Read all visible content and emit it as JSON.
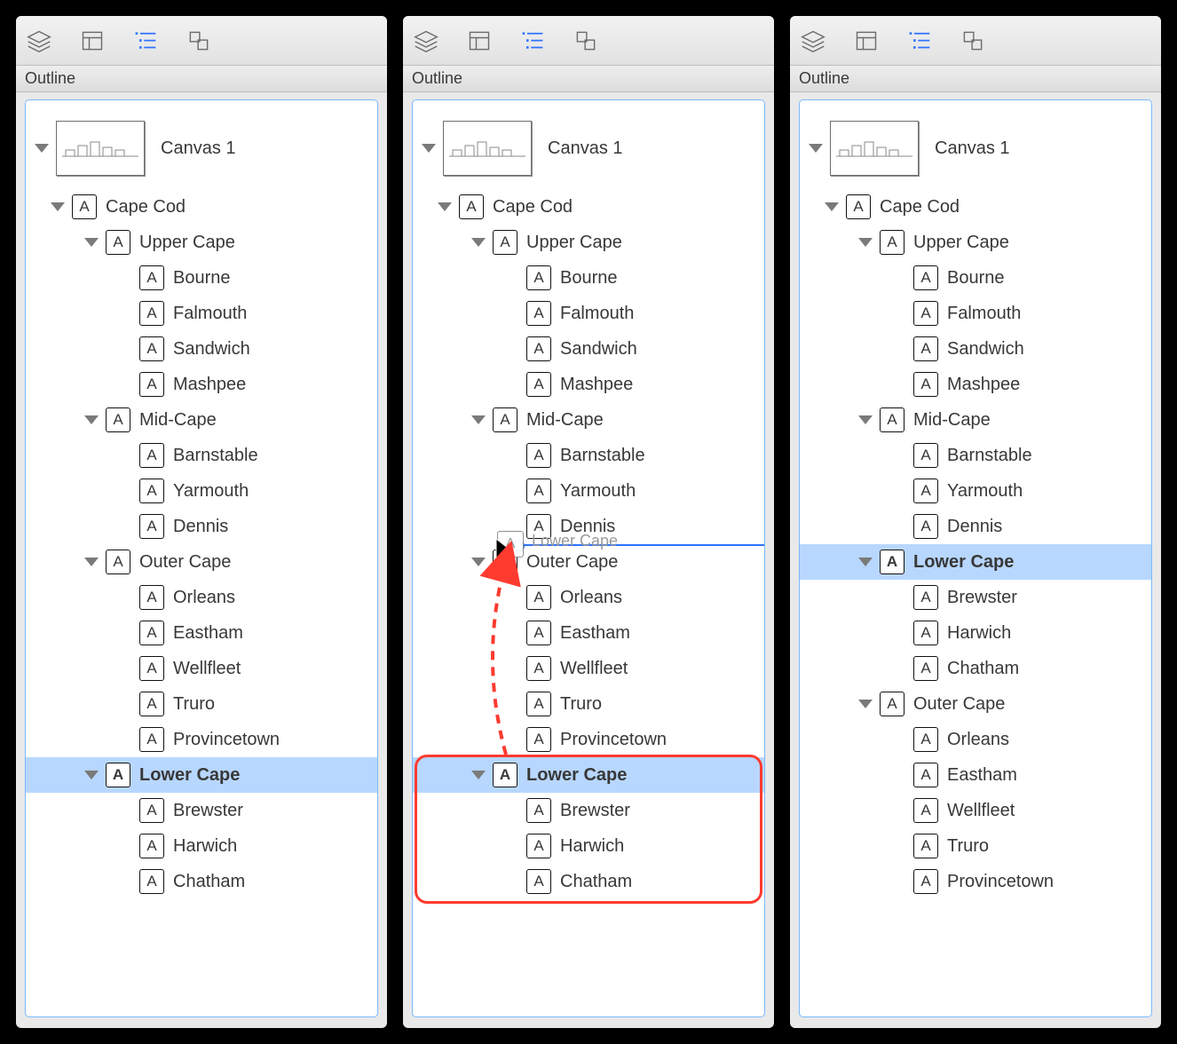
{
  "section_label": "Outline",
  "canvas_label": "Canvas 1",
  "a_glyph": "A",
  "badge_suffix": "-icon",
  "panels": [
    {
      "id": "panel-before",
      "selected_key": "lower-cape",
      "extras": {
        "ghost": false,
        "drop_line": false,
        "red_box": false,
        "arrow": false,
        "cursor": false
      },
      "rows": [
        {
          "key": "cape-cod",
          "label": "Cape Cod",
          "depth": 0,
          "disclosure": true
        },
        {
          "key": "upper-cape",
          "label": "Upper Cape",
          "depth": 1,
          "disclosure": true
        },
        {
          "key": "bourne",
          "label": "Bourne",
          "depth": 2,
          "disclosure": false
        },
        {
          "key": "falmouth",
          "label": "Falmouth",
          "depth": 2,
          "disclosure": false
        },
        {
          "key": "sandwich",
          "label": "Sandwich",
          "depth": 2,
          "disclosure": false
        },
        {
          "key": "mashpee",
          "label": "Mashpee",
          "depth": 2,
          "disclosure": false
        },
        {
          "key": "mid-cape",
          "label": "Mid-Cape",
          "depth": 1,
          "disclosure": true
        },
        {
          "key": "barnstable",
          "label": "Barnstable",
          "depth": 2,
          "disclosure": false
        },
        {
          "key": "yarmouth",
          "label": "Yarmouth",
          "depth": 2,
          "disclosure": false
        },
        {
          "key": "dennis",
          "label": "Dennis",
          "depth": 2,
          "disclosure": false
        },
        {
          "key": "outer-cape",
          "label": "Outer Cape",
          "depth": 1,
          "disclosure": true
        },
        {
          "key": "orleans",
          "label": "Orleans",
          "depth": 2,
          "disclosure": false
        },
        {
          "key": "eastham",
          "label": "Eastham",
          "depth": 2,
          "disclosure": false
        },
        {
          "key": "wellfleet",
          "label": "Wellfleet",
          "depth": 2,
          "disclosure": false
        },
        {
          "key": "truro",
          "label": "Truro",
          "depth": 2,
          "disclosure": false
        },
        {
          "key": "provincetown",
          "label": "Provincetown",
          "depth": 2,
          "disclosure": false
        },
        {
          "key": "lower-cape",
          "label": "Lower Cape",
          "depth": 1,
          "disclosure": true
        },
        {
          "key": "brewster",
          "label": "Brewster",
          "depth": 2,
          "disclosure": false
        },
        {
          "key": "harwich",
          "label": "Harwich",
          "depth": 2,
          "disclosure": false
        },
        {
          "key": "chatham",
          "label": "Chatham",
          "depth": 2,
          "disclosure": false
        }
      ]
    },
    {
      "id": "panel-during",
      "selected_key": "lower-cape",
      "extras": {
        "ghost": true,
        "ghost_glyph": "A",
        "drag_label": "Lower Cape",
        "drop_line": true,
        "drop_after_key": "dennis",
        "red_box": true,
        "red_from_key": "lower-cape",
        "red_to_key": "chatham",
        "arrow": true,
        "cursor": true
      },
      "rows": [
        {
          "key": "cape-cod",
          "label": "Cape Cod",
          "depth": 0,
          "disclosure": true
        },
        {
          "key": "upper-cape",
          "label": "Upper Cape",
          "depth": 1,
          "disclosure": true
        },
        {
          "key": "bourne",
          "label": "Bourne",
          "depth": 2,
          "disclosure": false
        },
        {
          "key": "falmouth",
          "label": "Falmouth",
          "depth": 2,
          "disclosure": false
        },
        {
          "key": "sandwich",
          "label": "Sandwich",
          "depth": 2,
          "disclosure": false
        },
        {
          "key": "mashpee",
          "label": "Mashpee",
          "depth": 2,
          "disclosure": false
        },
        {
          "key": "mid-cape",
          "label": "Mid-Cape",
          "depth": 1,
          "disclosure": true
        },
        {
          "key": "barnstable",
          "label": "Barnstable",
          "depth": 2,
          "disclosure": false
        },
        {
          "key": "yarmouth",
          "label": "Yarmouth",
          "depth": 2,
          "disclosure": false
        },
        {
          "key": "dennis",
          "label": "Dennis",
          "depth": 2,
          "disclosure": false
        },
        {
          "key": "outer-cape",
          "label": "Outer Cape",
          "depth": 1,
          "disclosure": true
        },
        {
          "key": "orleans",
          "label": "Orleans",
          "depth": 2,
          "disclosure": false
        },
        {
          "key": "eastham",
          "label": "Eastham",
          "depth": 2,
          "disclosure": false
        },
        {
          "key": "wellfleet",
          "label": "Wellfleet",
          "depth": 2,
          "disclosure": false
        },
        {
          "key": "truro",
          "label": "Truro",
          "depth": 2,
          "disclosure": false
        },
        {
          "key": "provincetown",
          "label": "Provincetown",
          "depth": 2,
          "disclosure": false
        },
        {
          "key": "lower-cape",
          "label": "Lower Cape",
          "depth": 1,
          "disclosure": true
        },
        {
          "key": "brewster",
          "label": "Brewster",
          "depth": 2,
          "disclosure": false
        },
        {
          "key": "harwich",
          "label": "Harwich",
          "depth": 2,
          "disclosure": false
        },
        {
          "key": "chatham",
          "label": "Chatham",
          "depth": 2,
          "disclosure": false
        }
      ]
    },
    {
      "id": "panel-after",
      "selected_key": "lower-cape",
      "extras": {
        "ghost": false,
        "drop_line": false,
        "red_box": false,
        "arrow": false,
        "cursor": false
      },
      "rows": [
        {
          "key": "cape-cod",
          "label": "Cape Cod",
          "depth": 0,
          "disclosure": true
        },
        {
          "key": "upper-cape",
          "label": "Upper Cape",
          "depth": 1,
          "disclosure": true
        },
        {
          "key": "bourne",
          "label": "Bourne",
          "depth": 2,
          "disclosure": false
        },
        {
          "key": "falmouth",
          "label": "Falmouth",
          "depth": 2,
          "disclosure": false
        },
        {
          "key": "sandwich",
          "label": "Sandwich",
          "depth": 2,
          "disclosure": false
        },
        {
          "key": "mashpee",
          "label": "Mashpee",
          "depth": 2,
          "disclosure": false
        },
        {
          "key": "mid-cape",
          "label": "Mid-Cape",
          "depth": 1,
          "disclosure": true
        },
        {
          "key": "barnstable",
          "label": "Barnstable",
          "depth": 2,
          "disclosure": false
        },
        {
          "key": "yarmouth",
          "label": "Yarmouth",
          "depth": 2,
          "disclosure": false
        },
        {
          "key": "dennis",
          "label": "Dennis",
          "depth": 2,
          "disclosure": false
        },
        {
          "key": "lower-cape",
          "label": "Lower Cape",
          "depth": 1,
          "disclosure": true
        },
        {
          "key": "brewster",
          "label": "Brewster",
          "depth": 2,
          "disclosure": false
        },
        {
          "key": "harwich",
          "label": "Harwich",
          "depth": 2,
          "disclosure": false
        },
        {
          "key": "chatham",
          "label": "Chatham",
          "depth": 2,
          "disclosure": false
        },
        {
          "key": "outer-cape",
          "label": "Outer Cape",
          "depth": 1,
          "disclosure": true
        },
        {
          "key": "orleans",
          "label": "Orleans",
          "depth": 2,
          "disclosure": false
        },
        {
          "key": "eastham",
          "label": "Eastham",
          "depth": 2,
          "disclosure": false
        },
        {
          "key": "wellfleet",
          "label": "Wellfleet",
          "depth": 2,
          "disclosure": false
        },
        {
          "key": "truro",
          "label": "Truro",
          "depth": 2,
          "disclosure": false
        },
        {
          "key": "provincetown",
          "label": "Provincetown",
          "depth": 2,
          "disclosure": false
        }
      ]
    }
  ]
}
